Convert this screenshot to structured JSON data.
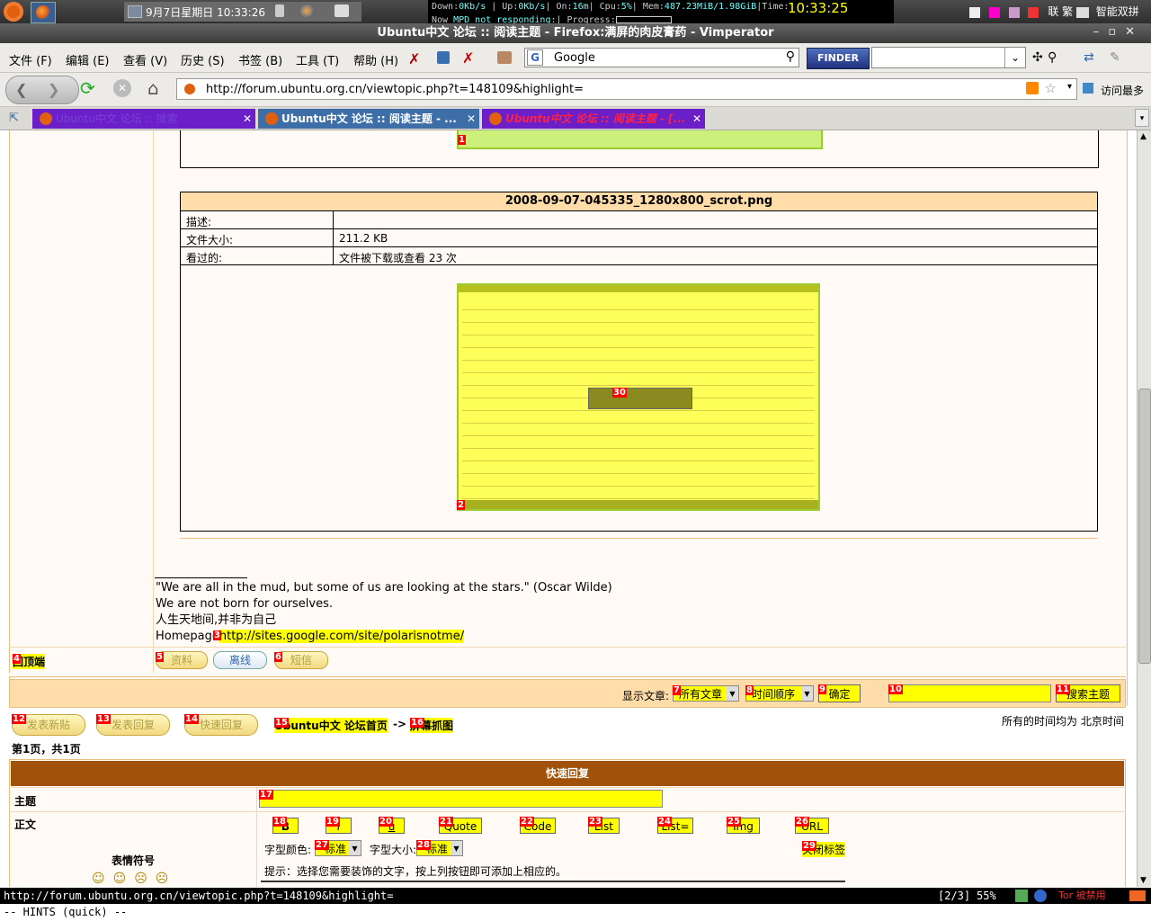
{
  "panel": {
    "clock": "9月7日星期日 10:33:26",
    "conky_line1_pre": "Down:",
    "conky_down": "0Kb/s",
    "conky_up_label": " | Up:",
    "conky_up": "0Kb/s",
    "conky_on_label": "| On:",
    "conky_on": "16m",
    "conky_cpu_label": "| Cpu:",
    "conky_cpu": "5%",
    "conky_mem_label": "| Mem:",
    "conky_mem": "487.23MiB/1.98GiB",
    "conky_time_label": "|Time:",
    "conky_time": "10:33:25",
    "conky_line2_pre": "Now ",
    "conky_mpd": "MPD not responding:",
    "conky_progress_label": "| Progress:",
    "tray_text": "联 繁 ",
    "input_method": "智能双拼"
  },
  "window": {
    "title": "Ubuntu中文 论坛 :: 阅读主题 - Firefox:满屏的肉皮膏药 - Vimperator"
  },
  "menubar": {
    "items": [
      "文件 (F)",
      "编辑 (E)",
      "查看 (V)",
      "历史 (S)",
      "书签 (B)",
      "工具 (T)",
      "帮助 (H)"
    ],
    "search_engine_text": "Google",
    "finder_label": "FINDER"
  },
  "navbar": {
    "url": "http://forum.ubuntu.org.cn/viewtopic.php?t=148109&highlight=",
    "most_visited": "访问最多"
  },
  "tabs": [
    {
      "label": "Ubuntu中文 论坛 :: 搜索"
    },
    {
      "label": "Ubuntu中文 论坛 :: 阅读主题 - ..."
    },
    {
      "label": "Ubuntu中文 论坛 :: 阅读主题 - [..."
    }
  ],
  "attachment": {
    "filename": "2008-09-07-045335_1280x800_scrot.png",
    "rows": [
      {
        "label": "描述:",
        "value": ""
      },
      {
        "label": "文件大小:",
        "value": "211.2 KB"
      },
      {
        "label": "看过的:",
        "value": "文件被下载或查看 23 次"
      }
    ]
  },
  "signature": {
    "quote": "\"We are all in the mud, but some of us are looking at the stars.\" (Oscar Wilde)",
    "line2": "We are not born for ourselves.",
    "line3": "人生天地间,并非为自己",
    "homepage_label": "Homepage",
    "homepage_url": "http://sites.google.com/site/polarisnotme/"
  },
  "post_actions": {
    "back_to_top": "回顶端",
    "profile": "资料",
    "offline": "离线",
    "pm": "短信"
  },
  "display_bar": {
    "label": "显示文章:",
    "filter_select": "所有文章",
    "order_select": "时间顺序",
    "confirm": "确定",
    "search_topic": "搜索主题"
  },
  "bottom_nav": {
    "new_topic": "发表新贴",
    "reply": "发表回复",
    "quick_reply": "快速回复",
    "forum_index": "Ubuntu中文 论坛首页",
    "arrow": "->",
    "subforum": "屏幕抓图",
    "timezone": "所有的时间均为 北京时间",
    "pages": "第1页，共1页"
  },
  "quick_reply": {
    "header": "快速回复",
    "subject_label": "主题",
    "body_label": "正文",
    "emoticons_label": "表情符号",
    "buttons": [
      "B",
      "i",
      "u",
      "Quote",
      "Code",
      "List",
      "List=",
      "Img",
      "URL"
    ],
    "font_color_label": "字型颜色:",
    "font_color_value": "标准",
    "font_size_label": "字型大小:",
    "font_size_value": "标准",
    "close_tags": "关闭标签",
    "hint_text": "提示：选择您需要装饰的文字，按上列按钮即可添加上相应的。"
  },
  "hints": [
    "1",
    "2",
    "3",
    "4",
    "5",
    "6",
    "7",
    "8",
    "9",
    "10",
    "11",
    "12",
    "13",
    "14",
    "15",
    "16",
    "17",
    "18",
    "19",
    "20",
    "21",
    "22",
    "23",
    "24",
    "25",
    "26",
    "27",
    "28",
    "29",
    "30"
  ],
  "statusbar": {
    "url": "http://forum.ubuntu.org.cn/viewtopic.php?t=148109&highlight=",
    "tab_pos": "[2/3]",
    "scroll_pct": "55%",
    "tor": "Tor 被禁用"
  },
  "cmdline": "-- HINTS (quick) --"
}
